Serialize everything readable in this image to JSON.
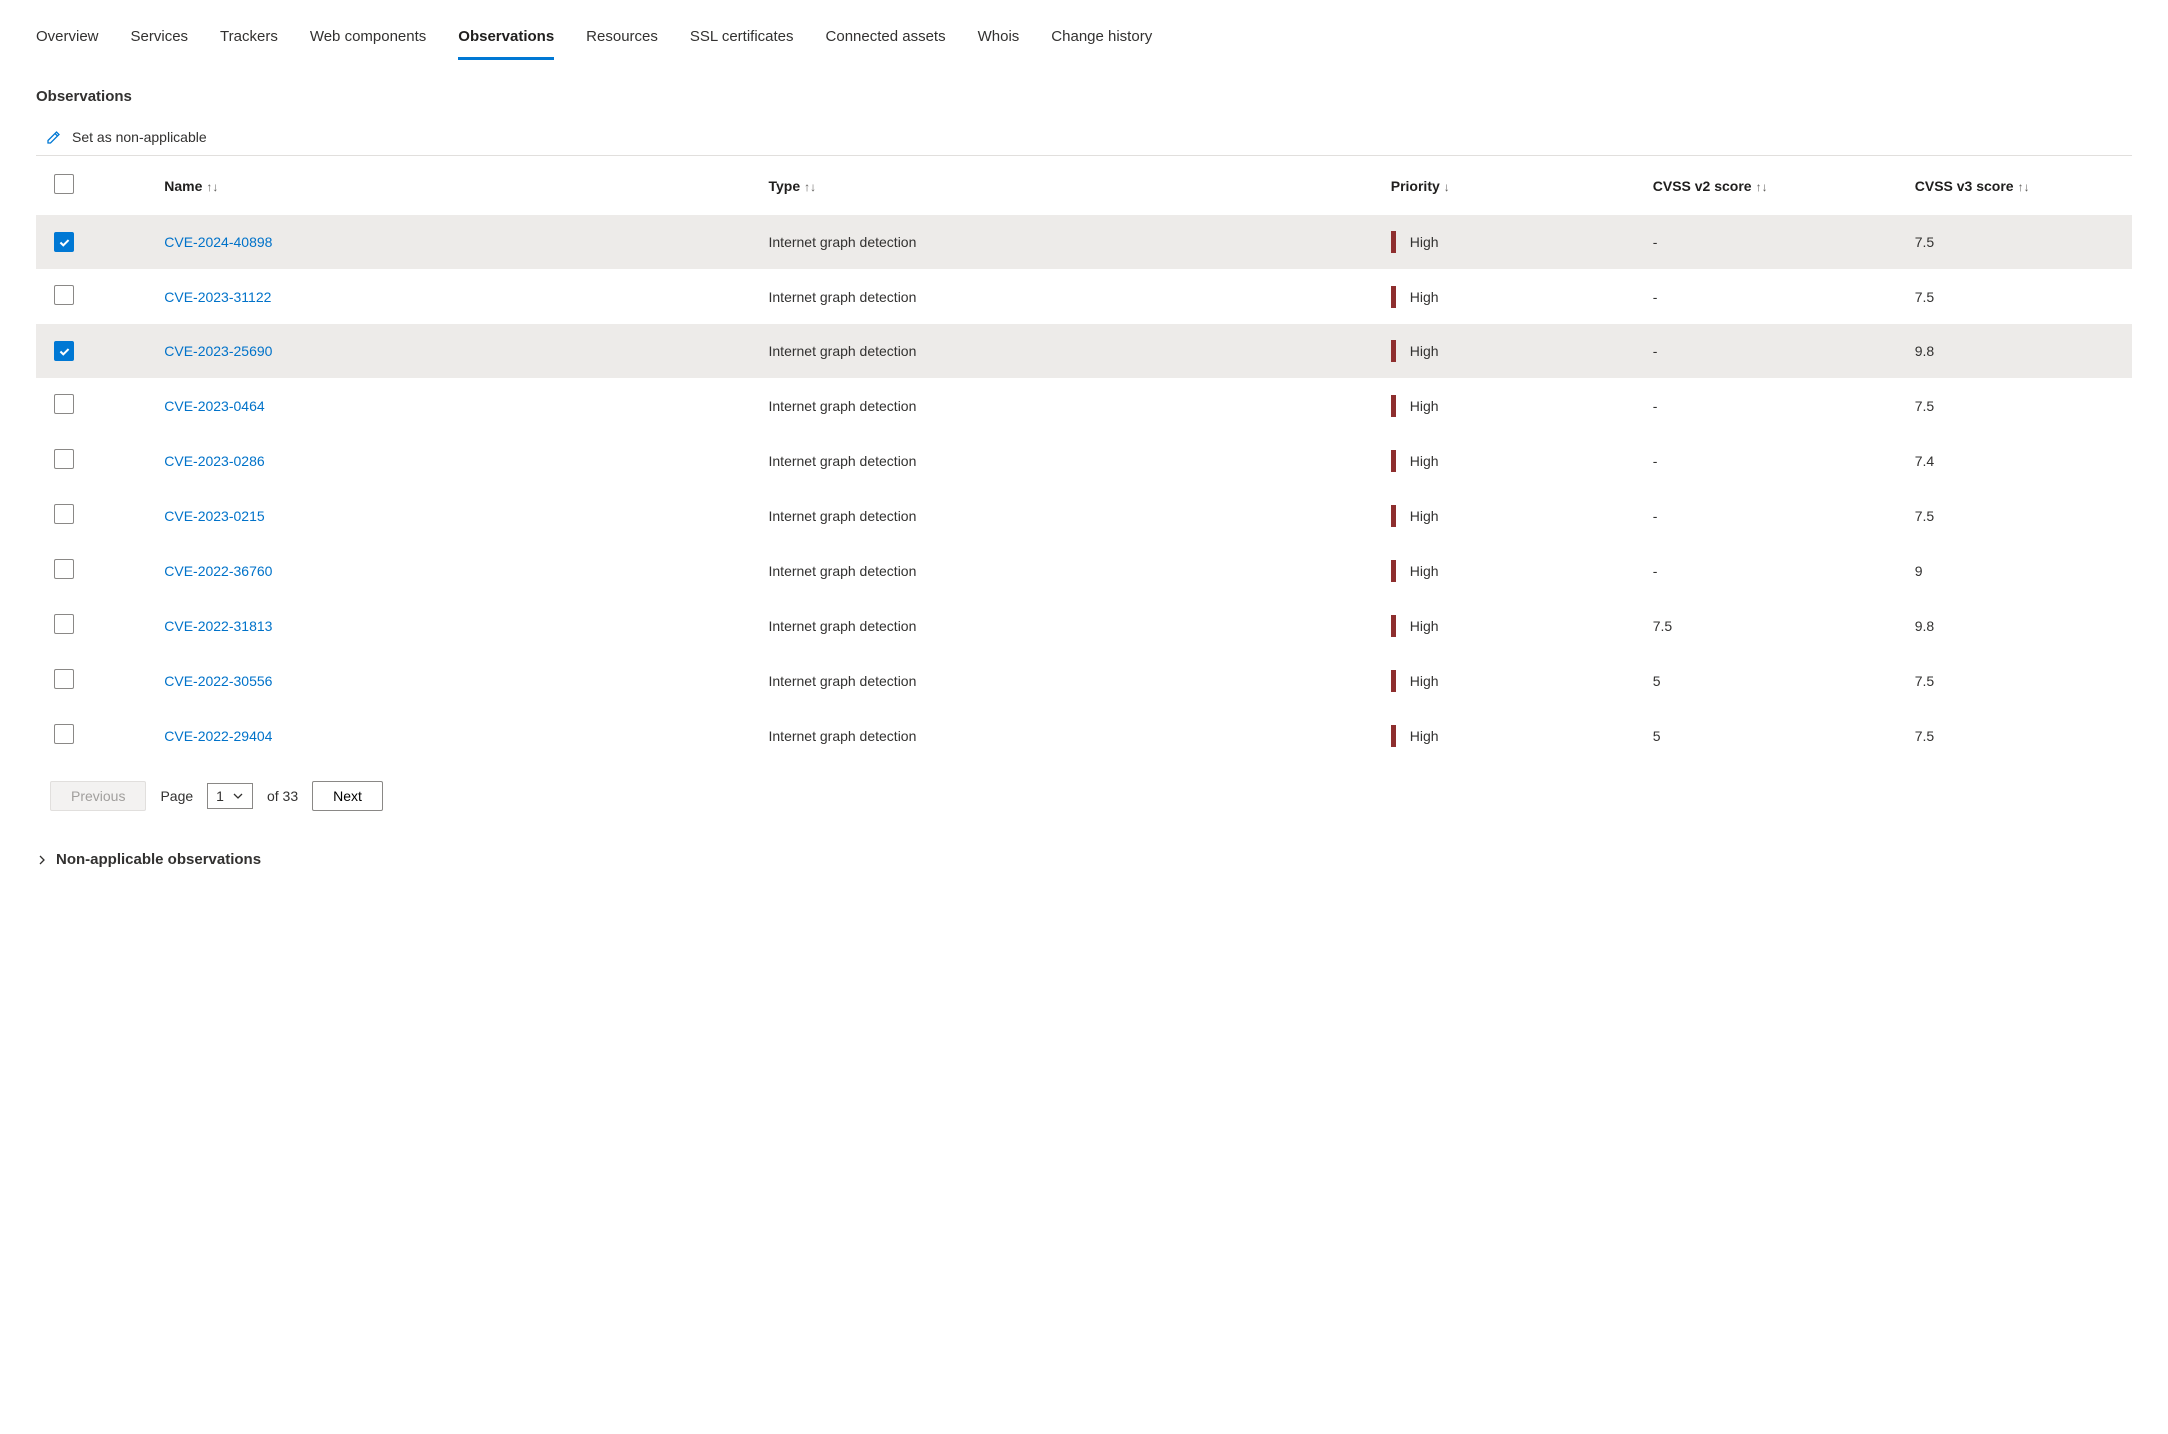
{
  "tabs": [
    "Overview",
    "Services",
    "Trackers",
    "Web components",
    "Observations",
    "Resources",
    "SSL certificates",
    "Connected assets",
    "Whois",
    "Change history"
  ],
  "active_tab_index": 4,
  "section_title": "Observations",
  "action_label": "Set as non-applicable",
  "columns": {
    "name": "Name",
    "type": "Type",
    "priority": "Priority",
    "cvss_v2": "CVSS v2 score",
    "cvss_v3": "CVSS v3 score"
  },
  "rows": [
    {
      "selected": true,
      "name": "CVE-2024-40898",
      "type": "Internet graph detection",
      "priority": "High",
      "v2": "-",
      "v3": "7.5"
    },
    {
      "selected": false,
      "name": "CVE-2023-31122",
      "type": "Internet graph detection",
      "priority": "High",
      "v2": "-",
      "v3": "7.5"
    },
    {
      "selected": true,
      "name": "CVE-2023-25690",
      "type": "Internet graph detection",
      "priority": "High",
      "v2": "-",
      "v3": "9.8"
    },
    {
      "selected": false,
      "name": "CVE-2023-0464",
      "type": "Internet graph detection",
      "priority": "High",
      "v2": "-",
      "v3": "7.5"
    },
    {
      "selected": false,
      "name": "CVE-2023-0286",
      "type": "Internet graph detection",
      "priority": "High",
      "v2": "-",
      "v3": "7.4"
    },
    {
      "selected": false,
      "name": "CVE-2023-0215",
      "type": "Internet graph detection",
      "priority": "High",
      "v2": "-",
      "v3": "7.5"
    },
    {
      "selected": false,
      "name": "CVE-2022-36760",
      "type": "Internet graph detection",
      "priority": "High",
      "v2": "-",
      "v3": "9"
    },
    {
      "selected": false,
      "name": "CVE-2022-31813",
      "type": "Internet graph detection",
      "priority": "High",
      "v2": "7.5",
      "v3": "9.8"
    },
    {
      "selected": false,
      "name": "CVE-2022-30556",
      "type": "Internet graph detection",
      "priority": "High",
      "v2": "5",
      "v3": "7.5"
    },
    {
      "selected": false,
      "name": "CVE-2022-29404",
      "type": "Internet graph detection",
      "priority": "High",
      "v2": "5",
      "v3": "7.5"
    }
  ],
  "pager": {
    "previous": "Previous",
    "page_label": "Page",
    "page_value": "1",
    "of_label": "of 33",
    "next": "Next"
  },
  "collapsible_title": "Non-applicable observations"
}
